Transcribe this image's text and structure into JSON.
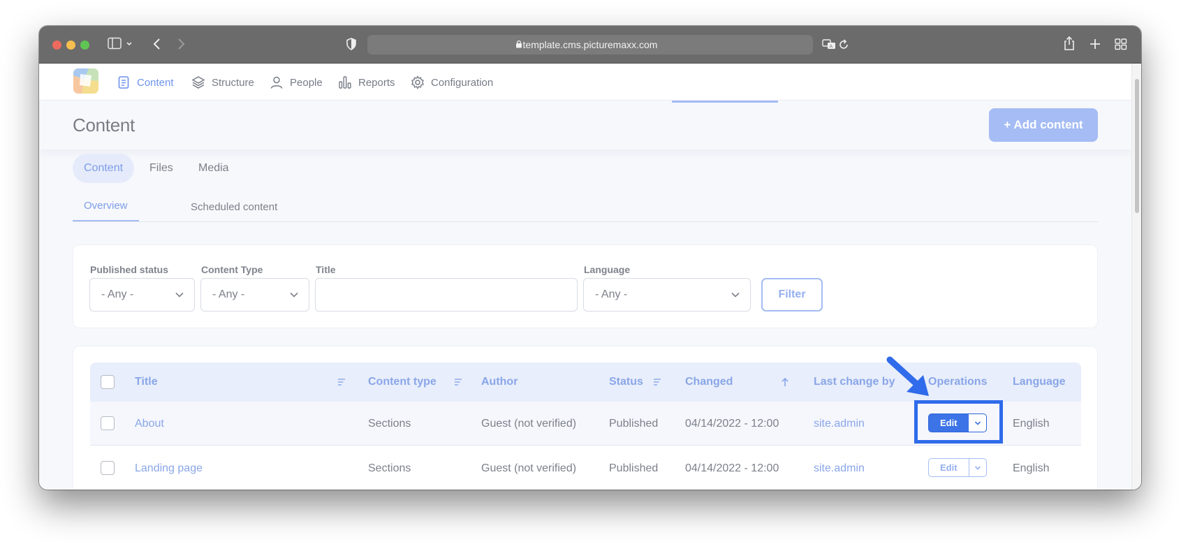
{
  "browser": {
    "url": "template.cms.picturemaxx.com",
    "icons": [
      "sidebar-icon",
      "chevron-down-icon",
      "back-icon",
      "forward-icon",
      "shield-icon",
      "lock-icon",
      "translate-icon",
      "reload-icon",
      "share-icon",
      "new-tab-icon",
      "tab-overview-icon"
    ]
  },
  "nav": {
    "items": [
      {
        "label": "Content",
        "icon": "document-icon",
        "active": true
      },
      {
        "label": "Structure",
        "icon": "layers-icon"
      },
      {
        "label": "People",
        "icon": "person-icon"
      },
      {
        "label": "Reports",
        "icon": "bar-chart-icon"
      },
      {
        "label": "Configuration",
        "icon": "gear-icon"
      }
    ]
  },
  "header": {
    "title": "Content",
    "add_button": "+ Add content"
  },
  "tabs": [
    "Content",
    "Files",
    "Media"
  ],
  "subtabs": [
    "Overview",
    "Scheduled content"
  ],
  "filters": {
    "published_status": {
      "label": "Published status",
      "value": "- Any -"
    },
    "content_type": {
      "label": "Content Type",
      "value": "- Any -"
    },
    "title": {
      "label": "Title",
      "value": ""
    },
    "language": {
      "label": "Language",
      "value": "- Any -"
    },
    "button": "Filter"
  },
  "table": {
    "headers": {
      "title": "Title",
      "content_type": "Content type",
      "author": "Author",
      "status": "Status",
      "changed": "Changed",
      "last_change_by": "Last change by",
      "operations": "Operations",
      "language": "Language"
    },
    "rows": [
      {
        "title": "About",
        "content_type": "Sections",
        "author": "Guest (not verified)",
        "status": "Published",
        "changed": "04/14/2022 - 12:00",
        "last_change_by": "site.admin",
        "operation": "Edit",
        "language": "English"
      },
      {
        "title": "Landing page",
        "content_type": "Sections",
        "author": "Guest (not verified)",
        "status": "Published",
        "changed": "04/14/2022 - 12:00",
        "last_change_by": "site.admin",
        "operation": "Edit",
        "language": "English"
      }
    ]
  },
  "colors": {
    "accent": "#6d93ec",
    "annotation": "#2f6bea",
    "button_primary": "#3c73e6"
  }
}
